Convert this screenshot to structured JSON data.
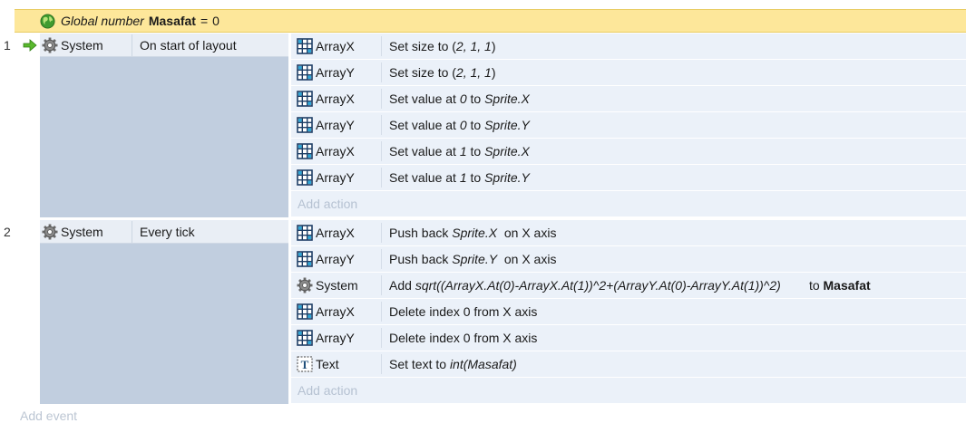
{
  "global": {
    "keyword": "Global number",
    "name": "Masafat",
    "equals": "=",
    "value": "0"
  },
  "events": [
    {
      "number": "1",
      "condition": {
        "object": "System",
        "text": "On start of layout",
        "trigger": true
      },
      "actions": [
        {
          "icon": "array-icon",
          "object": "ArrayX",
          "parts": [
            {
              "t": "Set size to ("
            },
            {
              "t": "2, 1, 1",
              "i": true
            },
            {
              "t": ")"
            }
          ]
        },
        {
          "icon": "array-icon",
          "object": "ArrayY",
          "parts": [
            {
              "t": "Set size to ("
            },
            {
              "t": "2, 1, 1",
              "i": true
            },
            {
              "t": ")"
            }
          ]
        },
        {
          "icon": "array-icon",
          "object": "ArrayX",
          "parts": [
            {
              "t": "Set value at "
            },
            {
              "t": "0",
              "i": true
            },
            {
              "t": " to "
            },
            {
              "t": "Sprite.X",
              "i": true
            }
          ]
        },
        {
          "icon": "array-icon",
          "object": "ArrayY",
          "parts": [
            {
              "t": "Set value at "
            },
            {
              "t": "0",
              "i": true
            },
            {
              "t": " to "
            },
            {
              "t": "Sprite.Y",
              "i": true
            }
          ]
        },
        {
          "icon": "array-icon",
          "object": "ArrayX",
          "parts": [
            {
              "t": "Set value at "
            },
            {
              "t": "1",
              "i": true
            },
            {
              "t": " to "
            },
            {
              "t": "Sprite.X",
              "i": true
            }
          ]
        },
        {
          "icon": "array-icon",
          "object": "ArrayY",
          "parts": [
            {
              "t": "Set value at "
            },
            {
              "t": "1",
              "i": true
            },
            {
              "t": " to "
            },
            {
              "t": "Sprite.Y",
              "i": true
            }
          ]
        }
      ],
      "add_action": "Add action"
    },
    {
      "number": "2",
      "condition": {
        "object": "System",
        "text": "Every tick",
        "trigger": false
      },
      "actions": [
        {
          "icon": "array-icon",
          "object": "ArrayX",
          "parts": [
            {
              "t": "Push back "
            },
            {
              "t": "Sprite.X",
              "i": true
            },
            {
              "t": "  on X axis"
            }
          ]
        },
        {
          "icon": "array-icon",
          "object": "ArrayY",
          "parts": [
            {
              "t": "Push back "
            },
            {
              "t": "Sprite.Y",
              "i": true
            },
            {
              "t": "  on X axis"
            }
          ]
        },
        {
          "icon": "gear-icon",
          "object": "System",
          "parts": [
            {
              "t": "Add "
            },
            {
              "t": "sqrt((ArrayX.At(0)-ArrayX.At(1))^2+(ArrayY.At(0)-ArrayY.At(1))^2)",
              "i": true
            },
            {
              "t": "        to "
            },
            {
              "t": "Masafat",
              "b": true
            }
          ]
        },
        {
          "icon": "array-icon",
          "object": "ArrayX",
          "parts": [
            {
              "t": "Delete index 0 from X axis"
            }
          ]
        },
        {
          "icon": "array-icon",
          "object": "ArrayY",
          "parts": [
            {
              "t": "Delete index 0 from X axis"
            }
          ]
        },
        {
          "icon": "text-icon",
          "object": "Text",
          "parts": [
            {
              "t": "Set text to "
            },
            {
              "t": "int(Masafat)",
              "i": true
            }
          ]
        }
      ],
      "add_action": "Add action"
    }
  ],
  "add_event": "Add event"
}
